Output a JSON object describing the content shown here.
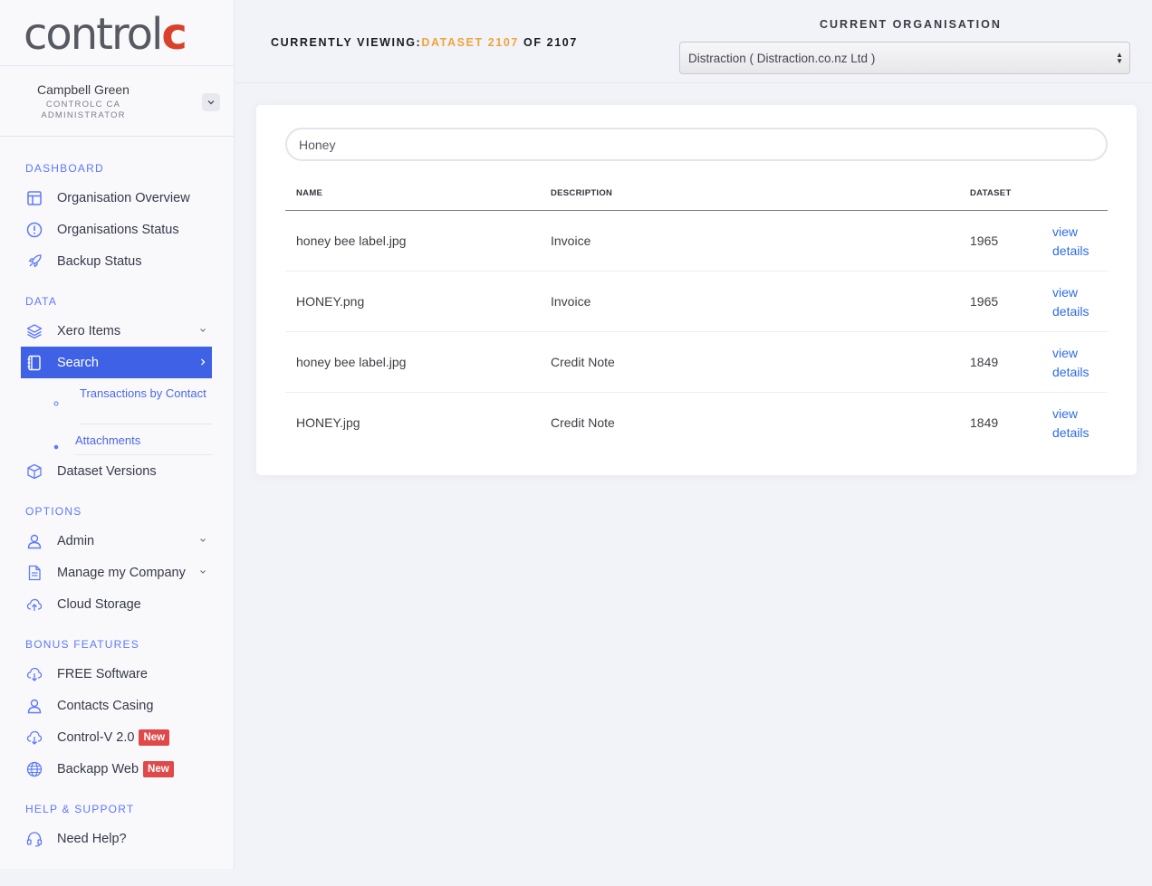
{
  "brand": {
    "logo_main": "control",
    "logo_accent": "c"
  },
  "user": {
    "name": "Campbell Green",
    "role_line1": "CONTROLC CA",
    "role_line2": "ADMINISTRATOR"
  },
  "sidebar": {
    "sections": {
      "dashboard": "DASHBOARD",
      "data": "DATA",
      "options": "OPTIONS",
      "bonus": "BONUS FEATURES",
      "help": "HELP & SUPPORT"
    },
    "items": {
      "org_overview": "Organisation Overview",
      "org_status": "Organisations Status",
      "backup_status": "Backup Status",
      "xero_items": "Xero Items",
      "search": "Search",
      "transactions_by_contact": "Transactions by Contact",
      "attachments": "Attachments",
      "dataset_versions": "Dataset Versions",
      "admin": "Admin",
      "manage_company": "Manage my Company",
      "cloud_storage": "Cloud Storage",
      "free_software": "FREE Software",
      "contacts_casing": "Contacts Casing",
      "control_v": "Control-V 2.0",
      "backapp_web": "Backapp Web",
      "need_help": "Need Help?"
    },
    "badge_new": "New"
  },
  "header": {
    "viewing_label": "CURRENTLY VIEWING:",
    "viewing_dataset": "DATASET 2107",
    "viewing_of": "OF 2107",
    "org_title": "CURRENT ORGANISATION",
    "org_selected": "Distraction ( Distraction.co.nz Ltd )"
  },
  "search": {
    "value": "Honey"
  },
  "table": {
    "columns": {
      "name": "NAME",
      "description": "DESCRIPTION",
      "dataset": "DATASET"
    },
    "link_line1": "view",
    "link_line2": "details",
    "rows": [
      {
        "name": "honey bee label.jpg",
        "description": "Invoice",
        "dataset": "1965"
      },
      {
        "name": "HONEY.png",
        "description": "Invoice",
        "dataset": "1965"
      },
      {
        "name": "honey bee label.jpg",
        "description": "Credit Note",
        "dataset": "1849"
      },
      {
        "name": "HONEY.jpg",
        "description": "Credit Note",
        "dataset": "1849"
      }
    ]
  },
  "colors": {
    "accent": "#3e61e6",
    "brand_red": "#d9412a",
    "highlight": "#f0a43c",
    "link": "#2c6ce8",
    "badge": "#e04949"
  }
}
